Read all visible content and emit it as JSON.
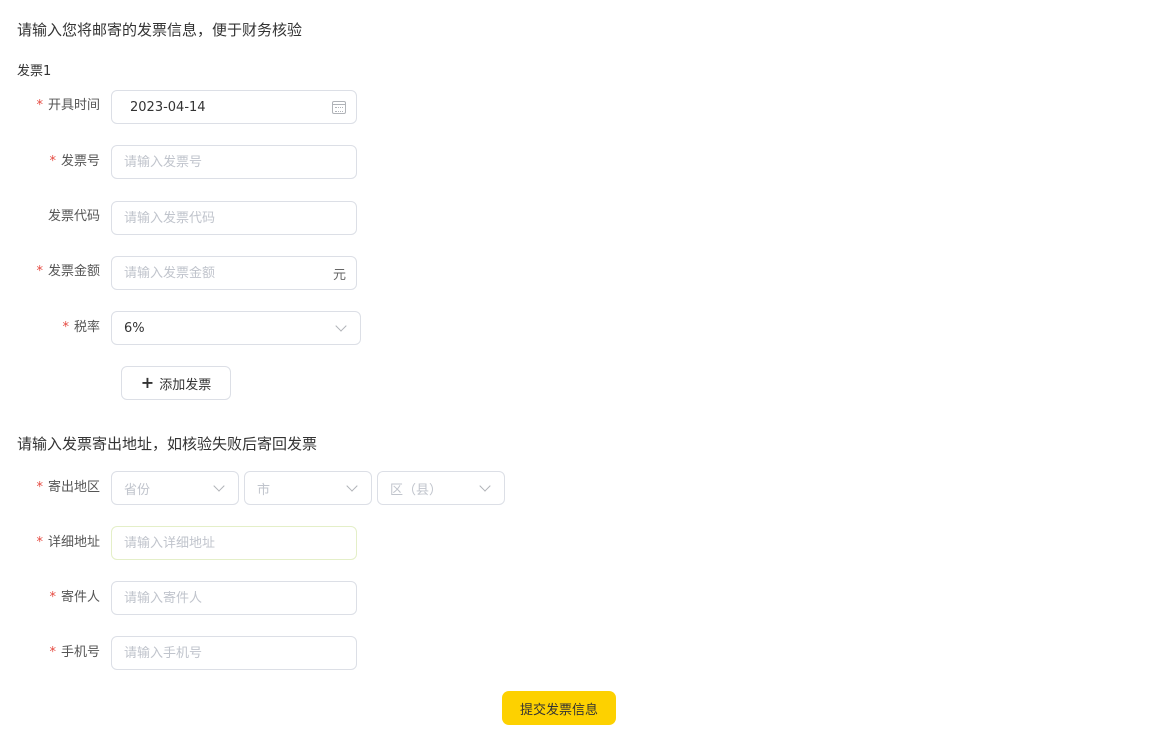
{
  "invoice_section": {
    "title": "请输入您将邮寄的发票信息，便于财务核验",
    "invoice_heading": "发票1",
    "fields": {
      "issue_date": {
        "label": "开具时间",
        "value": "2023-04-14",
        "required": true
      },
      "invoice_number": {
        "label": "发票号",
        "placeholder": "请输入发票号",
        "required": true
      },
      "invoice_code": {
        "label": "发票代码",
        "placeholder": "请输入发票代码",
        "required": false
      },
      "amount": {
        "label": "发票金额",
        "placeholder": "请输入发票金额",
        "suffix": "元",
        "required": true
      },
      "tax_rate": {
        "label": "税率",
        "value": "6%",
        "required": true
      }
    },
    "add_button_label": "添加发票",
    "required_mark": "*"
  },
  "address_section": {
    "title": "请输入发票寄出地址，如核验失败后寄回发票",
    "region": {
      "label": "寄出地区",
      "province_placeholder": "省份",
      "city_placeholder": "市",
      "district_placeholder": "区（县）",
      "required": true
    },
    "detail_address": {
      "label": "详细地址",
      "placeholder": "请输入详细地址",
      "required": true
    },
    "sender": {
      "label": "寄件人",
      "placeholder": "请输入寄件人",
      "required": true
    },
    "phone": {
      "label": "手机号",
      "placeholder": "请输入手机号",
      "required": true
    }
  },
  "submit_button_label": "提交发票信息",
  "colors": {
    "accent": "#fdd100",
    "required": "#e5483f",
    "border": "#dcdfe6",
    "placeholder": "#c0c4cc",
    "focused_border": "#e4efc8"
  },
  "icons": {
    "date_picker": "calendar-icon",
    "select": "chevron-down-icon",
    "add": "plus-icon"
  }
}
